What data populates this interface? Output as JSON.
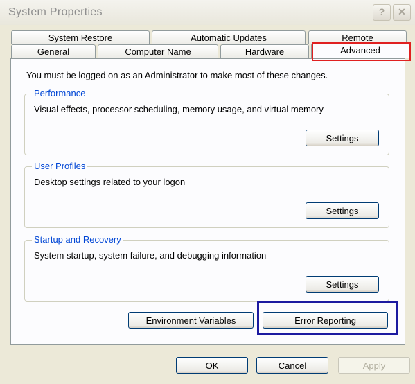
{
  "window": {
    "title": "System Properties",
    "help_glyph": "?",
    "close_glyph": "✕"
  },
  "tabs_row1": [
    "System Restore",
    "Automatic Updates",
    "Remote"
  ],
  "tabs_row2": [
    "General",
    "Computer Name",
    "Hardware",
    "Advanced"
  ],
  "intro": "You must be logged on as an Administrator to make most of these changes.",
  "performance": {
    "label": "Performance",
    "desc": "Visual effects, processor scheduling, memory usage, and virtual memory",
    "button": "Settings"
  },
  "user_profiles": {
    "label": "User Profiles",
    "desc": "Desktop settings related to your logon",
    "button": "Settings"
  },
  "startup": {
    "label": "Startup and Recovery",
    "desc": "System startup, system failure, and debugging information",
    "button": "Settings"
  },
  "env_button": "Environment Variables",
  "error_button": "Error Reporting",
  "footer": {
    "ok": "OK",
    "cancel": "Cancel",
    "apply": "Apply"
  },
  "colors": {
    "highlight_red": "#e02020",
    "highlight_blue": "#1c1aa0",
    "group_label": "#0046d5"
  }
}
